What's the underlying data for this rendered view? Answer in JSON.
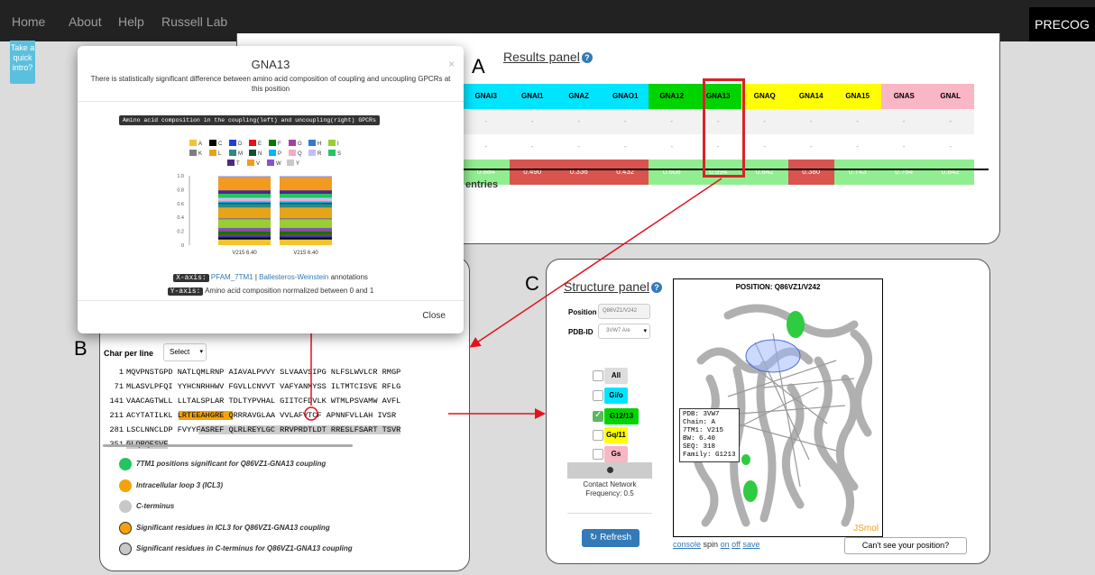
{
  "nav": {
    "items": [
      "Home",
      "About",
      "Help",
      "Russell Lab"
    ],
    "brand": "PRECOG"
  },
  "intro": {
    "label": "Take a quick intro?"
  },
  "results": {
    "letter": "A",
    "title": "Results panel",
    "columns": [
      "GNAI3",
      "GNAI1",
      "GNAZ",
      "GNAO1",
      "GNA12",
      "GNA13",
      "GNAQ",
      "GNA14",
      "GNA15",
      "GNAS",
      "GNAL"
    ],
    "row1": [
      "-",
      "-",
      "-",
      "-",
      "-",
      "-",
      "-",
      "-",
      "-",
      "-",
      "-"
    ],
    "row2": [
      "-",
      "-",
      "-",
      "-",
      "-",
      "-",
      "-",
      "-",
      "-",
      "-",
      "-"
    ],
    "row3": [
      "0.684",
      "0.490",
      "0.336",
      "0.432",
      "0.608",
      "0.994",
      "0.642",
      "0.380",
      "0.743",
      "0.764",
      "0.842"
    ],
    "entries": "entries"
  },
  "modal": {
    "title": "GNA13",
    "subtitle": "There is statistically significant difference between amino acid composition of coupling and uncoupling GPCRs at this position",
    "close_x": "×",
    "chart_header": "Amino acid composition in the coupling(left) and uncoupling(right) GPCRs",
    "xaxis_tag": "X-axis:",
    "xaxis_link1": "PFAM_7TM1",
    "xaxis_sep": " | ",
    "xaxis_link2": "Ballesteros-Weinstein",
    "xaxis_rest": " annotations",
    "yaxis_tag": "Y-axis:",
    "yaxis_text": "Amino acid composition normalized between 0 and 1",
    "close_button": "Close"
  },
  "chart_data": {
    "type": "bar",
    "stacked": true,
    "categories": [
      "V215 6.40",
      "V215 6.40"
    ],
    "ylim": [
      0,
      1.0
    ],
    "yticks": [
      "1.0",
      "0.8",
      "0.6",
      "0.4",
      "0.2",
      "0"
    ],
    "legend": [
      "A",
      "C",
      "D",
      "E",
      "F",
      "G",
      "H",
      "I",
      "K",
      "L",
      "M",
      "N",
      "P",
      "Q",
      "R",
      "S",
      "T",
      "V",
      "W",
      "Y"
    ],
    "colors": {
      "A": "#f4c430",
      "C": "#000000",
      "D": "#1f3ddb",
      "E": "#e3111b",
      "F": "#007a00",
      "G": "#a63ea8",
      "H": "#2e7bd1",
      "I": "#9acd32",
      "K": "#7f7f7f",
      "L": "#e8a317",
      "M": "#2b8a8a",
      "N": "#0f5132",
      "P": "#00b4ff",
      "Q": "#f6a9c4",
      "R": "#bfbfff",
      "S": "#22c55e",
      "T": "#4b2a82",
      "V": "#f29b1e",
      "W": "#8a4fd8",
      "Y": "#c8c8c8"
    },
    "series": [
      {
        "values": {
          "A": 0.08,
          "C": 0.03,
          "D": 0.02,
          "E": 0.02,
          "F": 0.05,
          "G": 0.04,
          "H": 0.01,
          "I": 0.12,
          "K": 0.02,
          "L": 0.15,
          "M": 0.05,
          "N": 0.02,
          "P": 0.02,
          "Q": 0.02,
          "R": 0.03,
          "S": 0.06,
          "T": 0.05,
          "V": 0.18,
          "W": 0.01,
          "Y": 0.02
        }
      },
      {
        "values": {
          "A": 0.08,
          "C": 0.03,
          "D": 0.02,
          "E": 0.02,
          "F": 0.05,
          "G": 0.04,
          "H": 0.01,
          "I": 0.12,
          "K": 0.02,
          "L": 0.15,
          "M": 0.05,
          "N": 0.02,
          "P": 0.02,
          "Q": 0.02,
          "R": 0.03,
          "S": 0.06,
          "T": 0.05,
          "V": 0.18,
          "W": 0.01,
          "Y": 0.02
        }
      }
    ]
  },
  "sequence": {
    "letter": "B",
    "char_label": "Char per line",
    "select": "Select",
    "lines": [
      {
        "n": "1",
        "text": "MQVPNSTGPD NATLQMLRNP AIAVALPVVY SLVAAVSIPG NLFSLWVLCR RMGP"
      },
      {
        "n": "71",
        "text": "MLASVLPFQI YYHCNRHHWV FGVLLCNVVT VAFYANMYSS ILTMTCISVE RFLG"
      },
      {
        "n": "141",
        "text": "VAACAGTWLL LLTALSPLAR TDLTYPVHAL GIITCFDVLK WTMLPSVAMW AVFL"
      },
      {
        "n": "211",
        "text": "ACYTATILKL LRTEEAHGRE QRRRAVGLAA VVLAFVTCF APNNFVLLAH IVSR"
      },
      {
        "n": "281",
        "text": "LSCLNNCLDP FVYYFASREF QLRLREYLGC RRVPRDTLDT RRESLFSART TSVR"
      },
      {
        "n": "351",
        "text": "GLQRQESVF"
      }
    ],
    "legend": [
      "7TM1 positions significant for Q86VZ1-GNA13 coupling",
      "Intracellular loop 3 (ICL3)",
      "C-terminus",
      "Significant residues in ICL3 for Q86VZ1-GNA13 coupling",
      "Significant residues in C-terminus for Q86VZ1-GNA13 coupling"
    ]
  },
  "structure": {
    "letter": "C",
    "title": "Structure panel",
    "position_label": "Position",
    "position_value": "Q86VZ1/V242",
    "pdb_label": "PDB-ID",
    "pdb_value": "3VW7 A/e",
    "filters": [
      {
        "label": "All",
        "color": "#dddddd",
        "checked": false
      },
      {
        "label": "Gi/o",
        "color": "#00e5ff",
        "checked": false
      },
      {
        "label": "G12/13",
        "color": "#00d400",
        "checked": true
      },
      {
        "label": "Gq/11",
        "color": "#ffff00",
        "checked": false
      },
      {
        "label": "Gs",
        "color": "#f9b6c4",
        "checked": false
      }
    ],
    "contact": "Contact Network",
    "frequency": "Frequency: 0.5",
    "refresh": "Refresh",
    "viewer_title": "POSITION: Q86VZ1/V242",
    "info": [
      "PDB: 3VW7",
      "Chain: A",
      "7TM1: V215",
      "BW: 6.40",
      "SEQ: 318",
      "Family: G1213"
    ],
    "jsmol": "JSmol",
    "console": "console",
    "spin": "spin",
    "on": "on",
    "off": "off",
    "save": "save",
    "cant_see": "Can't see your position?"
  },
  "colors": {
    "red": "#e3111b",
    "green": "#00d400",
    "orange": "#f4a20c",
    "good": "#90ee90",
    "bad": "#d9534f"
  }
}
